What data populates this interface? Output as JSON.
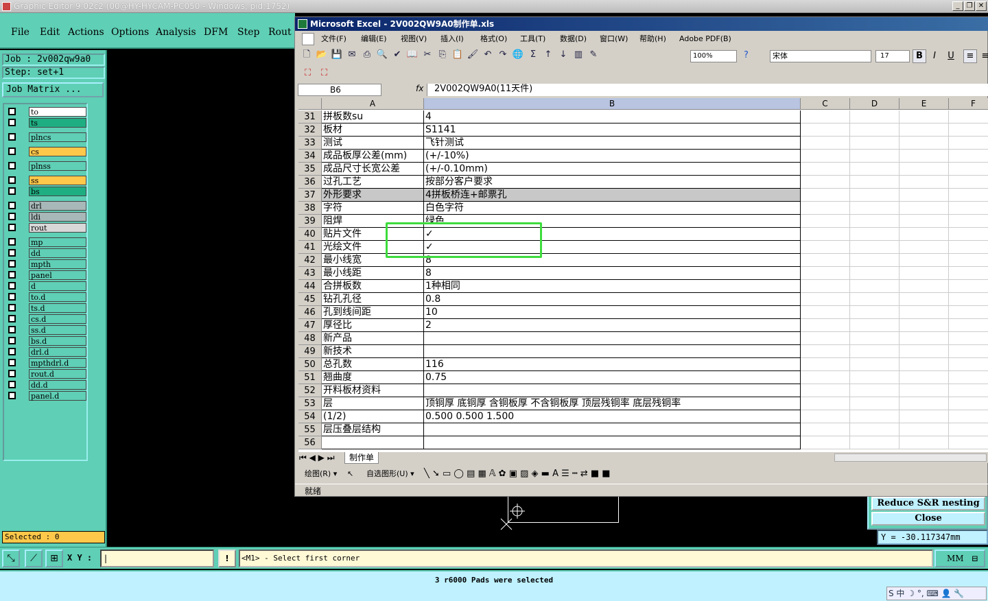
{
  "ge": {
    "title": "Graphic Editor 9.02c2 (00@HY-HYCAM-PC050 - Windows, pid:1752)",
    "menu": [
      "File",
      "Edit",
      "Actions",
      "Options",
      "Analysis",
      "DFM",
      "Step",
      "Rout"
    ],
    "job": "Job : 2v002qw9a0",
    "step": "Step: set+1",
    "job_matrix": "Job Matrix ...",
    "layers": [
      {
        "name": "to",
        "color": "#ffffff"
      },
      {
        "name": "ts",
        "color": "#1fae82"
      },
      {
        "name": "plncs",
        "color": "#5fcfb5"
      },
      {
        "name": "cs",
        "color": "#ffc84a"
      },
      {
        "name": "plnss",
        "color": "#5fcfb5"
      },
      {
        "name": "ss",
        "color": "#ffc84a"
      },
      {
        "name": "bs",
        "color": "#1fae82"
      },
      {
        "name": "drl",
        "color": "#a8b8b8"
      },
      {
        "name": "ldi",
        "color": "#a8b8b8"
      },
      {
        "name": "rout",
        "color": "#d8d8d8"
      },
      {
        "name": "mp",
        "color": "#5fcfb5"
      },
      {
        "name": "dd",
        "color": "#5fcfb5"
      },
      {
        "name": "mpth",
        "color": "#5fcfb5"
      },
      {
        "name": "panel",
        "color": "#5fcfb5"
      },
      {
        "name": "d",
        "color": "#5fcfb5"
      },
      {
        "name": "to.d",
        "color": "#5fcfb5"
      },
      {
        "name": "ts.d",
        "color": "#5fcfb5"
      },
      {
        "name": "cs.d",
        "color": "#5fcfb5"
      },
      {
        "name": "ss.d",
        "color": "#5fcfb5"
      },
      {
        "name": "bs.d",
        "color": "#5fcfb5"
      },
      {
        "name": "drl.d",
        "color": "#5fcfb5"
      },
      {
        "name": "mpthdrl.d",
        "color": "#5fcfb5"
      },
      {
        "name": "rout.d",
        "color": "#5fcfb5"
      },
      {
        "name": "dd.d",
        "color": "#5fcfb5"
      },
      {
        "name": "panel.d",
        "color": "#5fcfb5"
      }
    ],
    "selected": "Selected : 0",
    "xy_label": "X Y :",
    "prompt": "<M1> - Select first corner",
    "unit": "MM",
    "status": "3 r6000 Pads were selected",
    "reduce_btn": "Reduce S&R nesting",
    "close_btn": "Close",
    "coord": "Y = -30.117347mm",
    "ime": "S 中 ☽ °, ⌨ 👤 🔧"
  },
  "excel": {
    "title": "Microsoft Excel - 2V002QW9A0制作单.xls",
    "menu": [
      "文件(F)",
      "编辑(E)",
      "视图(V)",
      "插入(I)",
      "格式(O)",
      "工具(T)",
      "数据(D)",
      "窗口(W)",
      "帮助(H)",
      "Adobe PDF(B)"
    ],
    "zoom": "100%",
    "font_name": "宋体",
    "font_size": "17",
    "name_box": "B6",
    "formula": "2V002QW9A0(11天件)",
    "columns": [
      "A",
      "B",
      "C",
      "D",
      "E",
      "F"
    ],
    "rows": [
      {
        "n": "31",
        "a": "拼板数su",
        "b": "4"
      },
      {
        "n": "32",
        "a": "板材",
        "b": "S1141"
      },
      {
        "n": "33",
        "a": "测试",
        "b": "飞针测试"
      },
      {
        "n": "34",
        "a": "成品板厚公差(mm)",
        "b": "(+/-10%)"
      },
      {
        "n": "35",
        "a": "成品尺寸长宽公差",
        "b": "(+/-0.10mm)"
      },
      {
        "n": "36",
        "a": "过孔工艺",
        "b": "按部分客户要求"
      },
      {
        "n": "37",
        "a": "外形要求",
        "b": "4拼板桥连+邮票孔"
      },
      {
        "n": "38",
        "a": "字符",
        "b": "白色字符"
      },
      {
        "n": "39",
        "a": "阻焊",
        "b": "绿色"
      },
      {
        "n": "40",
        "a": "贴片文件",
        "b": "✓"
      },
      {
        "n": "41",
        "a": "光绘文件",
        "b": "✓"
      },
      {
        "n": "42",
        "a": "最小线宽",
        "b": "8"
      },
      {
        "n": "43",
        "a": "最小线距",
        "b": "8"
      },
      {
        "n": "44",
        "a": "合拼板数",
        "b": "1种相同"
      },
      {
        "n": "45",
        "a": "钻孔孔径",
        "b": "0.8"
      },
      {
        "n": "46",
        "a": "孔到线间距",
        "b": "10"
      },
      {
        "n": "47",
        "a": "厚径比",
        "b": "2"
      },
      {
        "n": "48",
        "a": "新产品",
        "b": ""
      },
      {
        "n": "49",
        "a": "新技术",
        "b": ""
      },
      {
        "n": "50",
        "a": "总孔数",
        "b": "116"
      },
      {
        "n": "51",
        "a": "翘曲度",
        "b": "0.75"
      },
      {
        "n": "52",
        "a": "开料板材资料",
        "b": ""
      },
      {
        "n": "53",
        "a": "层",
        "b": "顶铜厚  底铜厚  含铜板厚  不含铜板厚  顶层残铜率  底层残铜率"
      },
      {
        "n": "54",
        "a": "(1/2)",
        "b": "0.500  0.500   1.500"
      },
      {
        "n": "55",
        "a": "层压叠层结构",
        "b": ""
      },
      {
        "n": "56",
        "a": "",
        "b": ""
      }
    ],
    "sheet_tab": "制作单",
    "draw_label": "绘图(R) ▾",
    "autoshape_label": "自选图形(U) ▾",
    "status": "就绪"
  }
}
